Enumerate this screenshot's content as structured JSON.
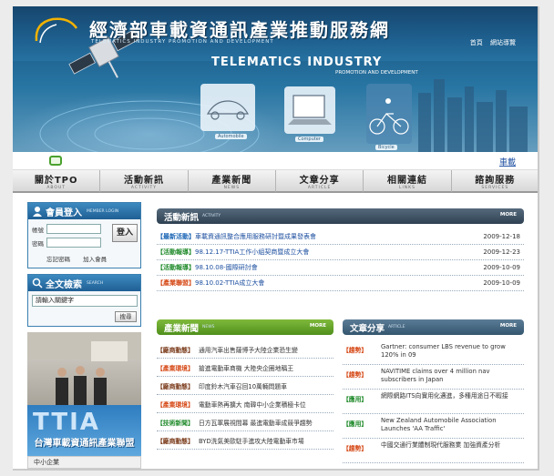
{
  "header": {
    "logo_text": "ITPO",
    "site_title": "經濟部車載資通訊產業推動服務網",
    "site_subtitle": "TELEMATICS INDUSTRY PROMOTION AND DEVELOPMENT",
    "links": [
      "首頁",
      "網站導覽"
    ],
    "banner_title": "TELEMATICS INDUSTRY",
    "banner_subtitle": "PROMOTION AND DEVELOPMENT",
    "captions": [
      "Automobile",
      "Computer",
      "Bicycle"
    ]
  },
  "strip": {
    "right_link": "車載"
  },
  "nav": [
    {
      "zh": "關於TPO",
      "en": "ABOUT"
    },
    {
      "zh": "活動新訊",
      "en": "ACTIVITY"
    },
    {
      "zh": "產業新聞",
      "en": "NEWS"
    },
    {
      "zh": "文章分享",
      "en": "ARTICLE"
    },
    {
      "zh": "相關連結",
      "en": "LINKS"
    },
    {
      "zh": "諮詢服務",
      "en": "SERVICES"
    }
  ],
  "login": {
    "title": "會員登入",
    "title_en": "MEMBER LOGIN",
    "account_label": "帳號",
    "password_label": "密碼",
    "button": "登入",
    "forgot": "忘記密碼",
    "join": "加入會員"
  },
  "search": {
    "title": "全文檢索",
    "title_en": "SEARCH",
    "value": "請輸入關鍵字",
    "button": "搜尋"
  },
  "ttia": {
    "big": "TTIA",
    "zh": "台灣車載資通訊產業聯盟"
  },
  "small_strip": "中小企業",
  "activity": {
    "title": "活動新訊",
    "title_en": "ACTIVITY",
    "more": "MORE",
    "items": [
      {
        "tag": "【最新活動】",
        "tag_color": "#1a64b4",
        "title": "車載資通訊整合應用服務研討暨成果發表會",
        "date": "2009-12-18"
      },
      {
        "tag": "【活動報導】",
        "tag_color": "#1f8a2a",
        "title": "98.12.17-TTIA工作小組契商暨成立大會",
        "date": "2009-12-23"
      },
      {
        "tag": "【活動報導】",
        "tag_color": "#1f8a2a",
        "title": "98.10.08-國際研討會",
        "date": "2009-10-09"
      },
      {
        "tag": "【產業聯盟】",
        "tag_color": "#d64a18",
        "title": "98.10.02-TTIA成立大會",
        "date": "2009-10-09"
      }
    ]
  },
  "news": {
    "title": "產業新聞",
    "title_en": "NEWS",
    "more": "MORE",
    "items": [
      {
        "tag": "【廠商動態】",
        "tag_color": "#7a3a1a",
        "title": "通用汽車出售薩博予大陸企業恐生變"
      },
      {
        "tag": "【產業環境】",
        "tag_color": "#d64a18",
        "title": "搶進電動車商機 大陸央企圈地稱王"
      },
      {
        "tag": "【廠商動態】",
        "tag_color": "#7a3a1a",
        "title": "印度鈴木汽車召回10萬輛問題車"
      },
      {
        "tag": "【產業環境】",
        "tag_color": "#d64a18",
        "title": "電動車熱再擴大 南韓中小企業積極卡位"
      },
      {
        "tag": "【技術新聞】",
        "tag_color": "#1f8a2a",
        "title": "日方瓦軍展視間幕 最進電動車成競爭趨勢"
      },
      {
        "tag": "【廠商動態】",
        "tag_color": "#7a3a1a",
        "title": "BYD洗氣美歐駐手進攻大陸電動車市場"
      }
    ]
  },
  "article": {
    "title": "文章分享",
    "title_en": "ARTICLE",
    "more": "MORE",
    "items": [
      {
        "tag": "【趨勢】",
        "tag_color": "#d64a18",
        "title": "Gartner: consumer LBS revenue to grow 120% in 09"
      },
      {
        "tag": "【趨勢】",
        "tag_color": "#d64a18",
        "title": "NAVITIME claims over 4 million nav subscribers in Japan"
      },
      {
        "tag": "【應用】",
        "tag_color": "#1f8a2a",
        "title": "網際網路ITS向實用化邁進，多種用途日不暇接"
      },
      {
        "tag": "【應用】",
        "tag_color": "#1f8a2a",
        "title": "New Zealand Automobile Association Launches 'AA Traffic'"
      },
      {
        "tag": "【趨勢】",
        "tag_color": "#d64a18",
        "title": "中國交通行業體制現代服務業 加強資產分析"
      }
    ]
  }
}
